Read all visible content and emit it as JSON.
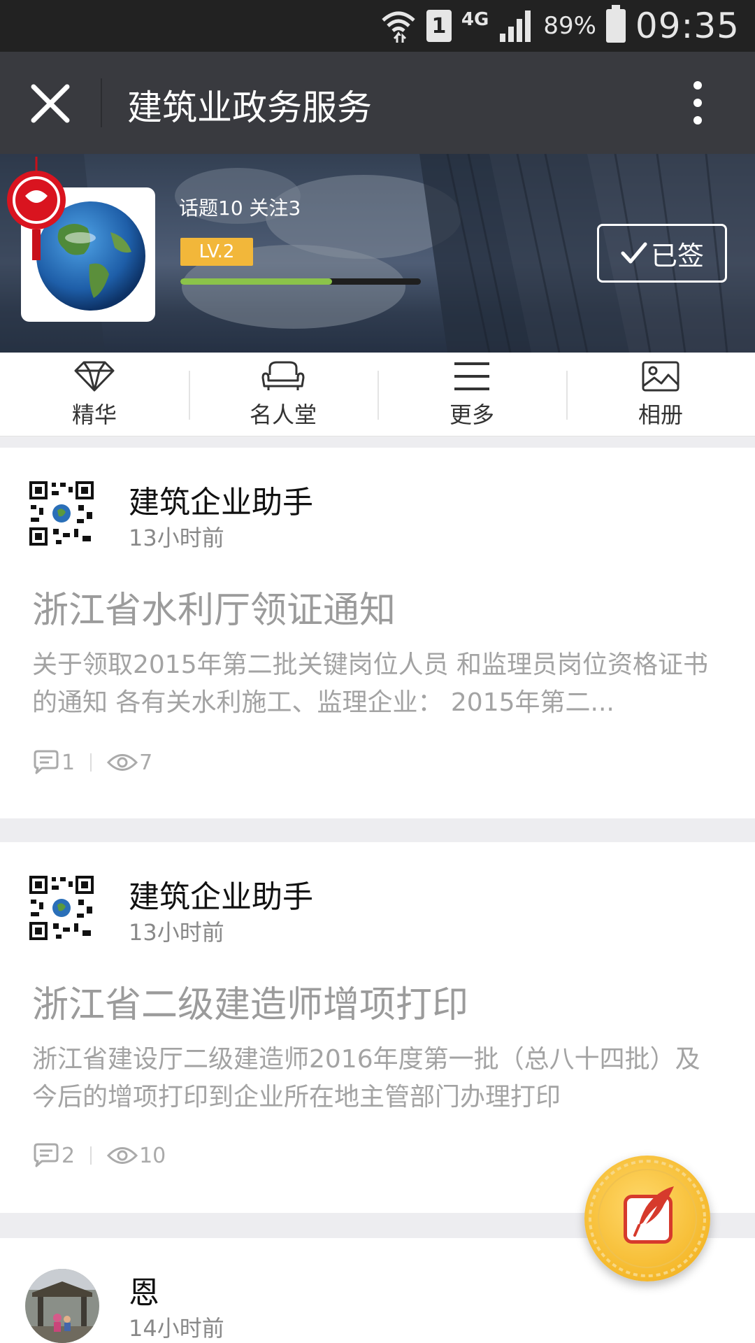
{
  "status_bar": {
    "network": "4G",
    "sim": "1",
    "battery": "89%",
    "time": "09:35"
  },
  "app_bar": {
    "title": "建筑业政务服务"
  },
  "profile": {
    "stats": "话题10  关注3",
    "level": "LV.2",
    "level_progress": 0.63,
    "signed_label": "已签"
  },
  "quick_nav": [
    {
      "label": "精华",
      "icon": "diamond-icon"
    },
    {
      "label": "名人堂",
      "icon": "sofa-icon"
    },
    {
      "label": "更多",
      "icon": "menu-icon"
    },
    {
      "label": "相册",
      "icon": "image-icon"
    }
  ],
  "posts": [
    {
      "author": "建筑企业助手",
      "time": "13小时前",
      "title": "浙江省水利厅领证通知",
      "excerpt": "关于领取2015年第二批关键岗位人员 和监理员岗位资格证书的通知   各有关水利施工、监理企业： 2015年第二...",
      "comments": "1",
      "views": "7"
    },
    {
      "author": "建筑企业助手",
      "time": "13小时前",
      "title": "浙江省二级建造师增项打印",
      "excerpt": "浙江省建设厅二级建造师2016年度第一批（总八十四批）及今后的增项打印到企业所在地主管部门办理打印",
      "comments": "2",
      "views": "10"
    },
    {
      "author": "恩",
      "time": "14小时前"
    }
  ],
  "colors": {
    "status_bar": "#222222",
    "app_bar": "#393a3f",
    "level_badge": "#f2b73a",
    "progress_fill": "#8bc34a",
    "fab": "#f5b92c"
  }
}
